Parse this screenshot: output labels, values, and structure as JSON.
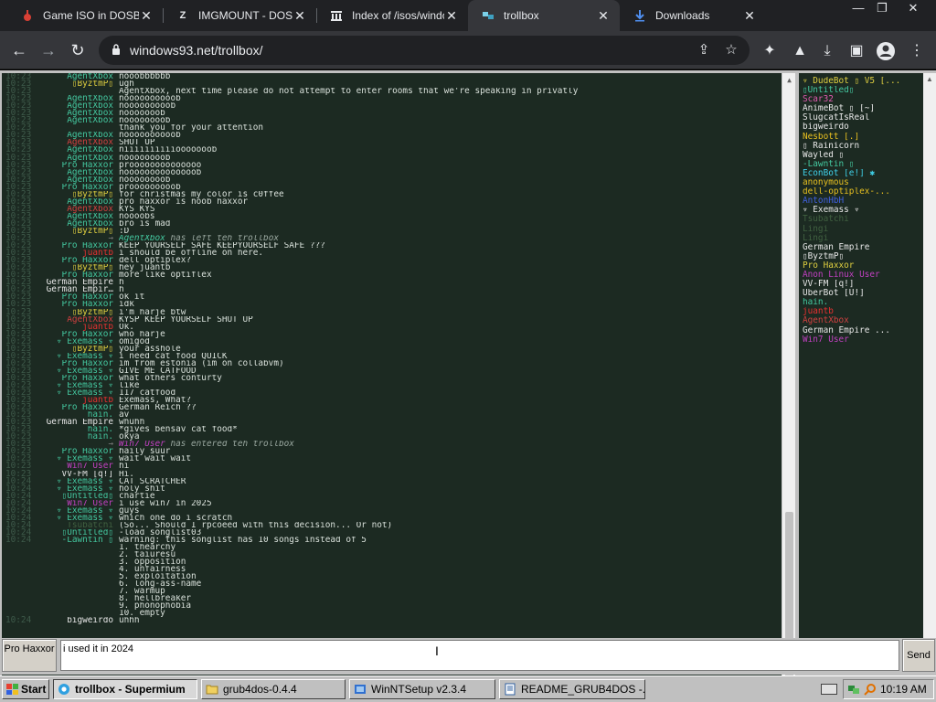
{
  "browser": {
    "tabs": [
      {
        "title": "Game ISO in DOSB",
        "icon": "controller-icon",
        "active": false
      },
      {
        "title": "IMGMOUNT - DOSI",
        "icon": "z-logo-icon",
        "active": false
      },
      {
        "title": "Index of /isos/windo",
        "icon": "archive-org-icon",
        "active": false
      },
      {
        "title": "trollbox",
        "icon": "trollbox-icon",
        "active": true
      },
      {
        "title": "Downloads",
        "icon": "download-icon",
        "active": false
      }
    ],
    "url": "windows93.net/trollbox/"
  },
  "chat": {
    "messages": [
      {
        "time": "10:23",
        "nick": "AgentXbox",
        "color": "#44c8a0",
        "text": "nooobbbbbb"
      },
      {
        "time": "10:23",
        "nick": "▯ByztmP▯",
        "color": "#e0d040",
        "text": "ugh"
      },
      {
        "time": "10:23",
        "nick": "",
        "color": "#44c8a0",
        "text": "AgentXbox, next time please do not attempt to enter rooms that we're speaking in privatly"
      },
      {
        "time": "10:23",
        "nick": "AgentXbox",
        "color": "#44c8a0",
        "text": "noooooooooob"
      },
      {
        "time": "10:23",
        "nick": "AgentXbox",
        "color": "#44c8a0",
        "text": "nooooooooob"
      },
      {
        "time": "10:23",
        "nick": "AgentXbox",
        "color": "#44c8a0",
        "text": "nooooooob"
      },
      {
        "time": "10:23",
        "nick": "AgentXbox",
        "color": "#44c8a0",
        "text": "noooooooob"
      },
      {
        "time": "10:23",
        "nick": "",
        "color": "#44c8a0",
        "text": "thank you for your attention"
      },
      {
        "time": "10:23",
        "nick": "AgentXbox",
        "color": "#44c8a0",
        "text": "noooooooooob"
      },
      {
        "time": "10:23",
        "nick": "AgentXbox",
        "color": "#d04040",
        "text": "SHUT UP"
      },
      {
        "time": "10:23",
        "nick": "AgentXbox",
        "color": "#44c8a0",
        "text": "niiiiiiiiiiooooooob"
      },
      {
        "time": "10:23",
        "nick": "AgentXbox",
        "color": "#44c8a0",
        "text": "noooooooob"
      },
      {
        "time": "10:23",
        "nick": "Pro Haxxor",
        "color": "#44c8a0",
        "text": "proooooooooooooo"
      },
      {
        "time": "10:23",
        "nick": "AgentXbox",
        "color": "#44c8a0",
        "text": "noooooooooooooob"
      },
      {
        "time": "10:23",
        "nick": "AgentXbox",
        "color": "#44c8a0",
        "text": "noooooooob"
      },
      {
        "time": "10:23",
        "nick": "Pro Haxxor",
        "color": "#44c8a0",
        "text": "prooooooooob"
      },
      {
        "time": "10:23",
        "nick": "▯ByztmP▯",
        "color": "#e0d040",
        "text": "for christmas my color is c0ffee"
      },
      {
        "time": "10:23",
        "nick": "AgentXbox",
        "color": "#44c8a0",
        "text": "pro haxxor is noob haxxor"
      },
      {
        "time": "10:23",
        "nick": "AgentXbox",
        "color": "#d04040",
        "text": "KYS KYS"
      },
      {
        "time": "10:23",
        "nick": "AgentXbox",
        "color": "#44c8a0",
        "text": "noooobs"
      },
      {
        "time": "10:23",
        "nick": "AgentXbox",
        "color": "#44c8a0",
        "text": "bro is mad"
      },
      {
        "time": "10:23",
        "nick": "▯ByztmP▯",
        "color": "#e0d040",
        "text": ":D"
      },
      {
        "time": "10:23",
        "nick": "→",
        "color": "#808080",
        "text": "",
        "system": true,
        "sys_nick": "AgentXbox",
        "sys_nick_color": "#44c8a0",
        "sys_text": " has left teh trollbox"
      },
      {
        "time": "10:23",
        "nick": "Pro Haxxor",
        "color": "#44c8a0",
        "text": "KEEP YOURSELF SAFE KEEPYOURSELF SAFE ???"
      },
      {
        "time": "10:23",
        "nick": "juantb",
        "color": "#e83030",
        "text": "i should be offline on here."
      },
      {
        "time": "10:23",
        "nick": "Pro Haxxor",
        "color": "#44c8a0",
        "text": "dell optiplex?"
      },
      {
        "time": "10:23",
        "nick": "▯ByztmP▯",
        "color": "#e0d040",
        "text": "hey juantb"
      },
      {
        "time": "10:23",
        "nick": "Pro Haxxor",
        "color": "#44c8a0",
        "text": "more like optiflex"
      },
      {
        "time": "10:23",
        "nick": "German Empire",
        "color": "#e8e8e8",
        "text": "h"
      },
      {
        "time": "10:23",
        "nick": "German Empir…",
        "color": "#e8e8e8",
        "text": "h"
      },
      {
        "time": "10:23",
        "nick": "Pro Haxxor",
        "color": "#44c8a0",
        "text": "ok it"
      },
      {
        "time": "10:23",
        "nick": "Pro Haxxor",
        "color": "#44c8a0",
        "text": "idk"
      },
      {
        "time": "10:23",
        "nick": "▯ByztmP▯",
        "color": "#e0d040",
        "text": "i'm harje btw"
      },
      {
        "time": "10:23",
        "nick": "AgentXbox",
        "color": "#d04040",
        "text": "KYSP KEEP YOURSELF SHUT UP"
      },
      {
        "time": "10:23",
        "nick": "juantb",
        "color": "#e83030",
        "text": "Ok."
      },
      {
        "time": "10:23",
        "nick": "Pro Haxxor",
        "color": "#44c8a0",
        "text": "who harje"
      },
      {
        "time": "10:23",
        "nick": "▿ Exemass ▿",
        "color": "#44c8a0",
        "text": "omigod"
      },
      {
        "time": "10:23",
        "nick": "▯ByztmP▯",
        "color": "#e0d040",
        "text": "your asshole"
      },
      {
        "time": "10:23",
        "nick": "▿ Exemass ▿",
        "color": "#44c8a0",
        "text": "i need cat food QUICK"
      },
      {
        "time": "10:23",
        "nick": "Pro Haxxor",
        "color": "#44c8a0",
        "text": "im from estonia (im on collabvm)"
      },
      {
        "time": "10:23",
        "nick": "▿ Exemass ▿",
        "color": "#44c8a0",
        "text": "GIVE ME CATFOOD"
      },
      {
        "time": "10:23",
        "nick": "Pro Haxxor",
        "color": "#44c8a0",
        "text": "what others conturty"
      },
      {
        "time": "10:23",
        "nick": "▿ Exemass ▿",
        "color": "#44c8a0",
        "text": "like"
      },
      {
        "time": "10:23",
        "nick": "▿ Exemass ▿",
        "color": "#44c8a0",
        "text": "117 catfood"
      },
      {
        "time": "10:23",
        "nick": "juantb",
        "color": "#e83030",
        "text": "Exemass, What?"
      },
      {
        "time": "10:23",
        "nick": "Pro Haxxor",
        "color": "#44c8a0",
        "text": "German Reich ??"
      },
      {
        "time": "10:23",
        "nick": "hain.",
        "color": "#44c8a0",
        "text": "av"
      },
      {
        "time": "10:23",
        "nick": "German Empire",
        "color": "#e8e8e8",
        "text": "whuhh"
      },
      {
        "time": "10:23",
        "nick": "hain.",
        "color": "#44c8a0",
        "text": "*gives bensav cat food*"
      },
      {
        "time": "10:23",
        "nick": "hain.",
        "color": "#44c8a0",
        "text": "okya"
      },
      {
        "time": "10:23",
        "nick": "→",
        "color": "#808080",
        "text": "",
        "system": true,
        "sys_nick": "Win7 User",
        "sys_nick_color": "#c040c0",
        "sys_text": " has entered teh trollbox"
      },
      {
        "time": "10:23",
        "nick": "Pro Haxxor",
        "color": "#44c8a0",
        "text": "haily suur"
      },
      {
        "time": "10:23",
        "nick": "▿ Exemass ▿",
        "color": "#44c8a0",
        "text": "wait wait wait"
      },
      {
        "time": "10:23",
        "nick": "Win7 User",
        "color": "#c040c0",
        "text": "hi"
      },
      {
        "time": "10:23",
        "nick": "VV-FM [q!]",
        "color": "#e8e8e8",
        "text": "Hi."
      },
      {
        "time": "10:24",
        "nick": "▿ Exemass ▿",
        "color": "#44c8a0",
        "text": "CAT SCRATCHER"
      },
      {
        "time": "10:24",
        "nick": "▿ Exemass ▿",
        "color": "#44c8a0",
        "text": "holy shit"
      },
      {
        "time": "10:24",
        "nick": "▯Untitled▯",
        "color": "#44c8a0",
        "text": "chartie"
      },
      {
        "time": "10:24",
        "nick": "Win7 User",
        "color": "#c040c0",
        "text": "i use win7 in 2025"
      },
      {
        "time": "10:24",
        "nick": "▿ Exemass ▿",
        "color": "#44c8a0",
        "text": "guys"
      },
      {
        "time": "10:24",
        "nick": "▿ Exemass ▿",
        "color": "#44c8a0",
        "text": "which one do i scratch"
      },
      {
        "time": "10:24",
        "nick": "Tsubatchi",
        "color": "#406040",
        "text": "(So... Should I rpcoeed with this decision... Or not)"
      },
      {
        "time": "10:24",
        "nick": "▯Untitled▯",
        "color": "#44c8a0",
        "text": "-load songlist03"
      },
      {
        "time": "10:24",
        "nick": "-Lawntin ▯",
        "color": "#44c8a0",
        "text": "warning: this songlist has 10 songs instead of 5"
      },
      {
        "time": "",
        "nick": "",
        "color": "#44c8a0",
        "text": "1. thearchy"
      },
      {
        "time": "",
        "nick": "",
        "color": "#44c8a0",
        "text": "2. taiuresu"
      },
      {
        "time": "",
        "nick": "",
        "color": "#44c8a0",
        "text": "3. opposition"
      },
      {
        "time": "",
        "nick": "",
        "color": "#44c8a0",
        "text": "4. unfairness"
      },
      {
        "time": "",
        "nick": "",
        "color": "#44c8a0",
        "text": "5. exploitation"
      },
      {
        "time": "",
        "nick": "",
        "color": "#44c8a0",
        "text": "6. long-ass-name"
      },
      {
        "time": "",
        "nick": "",
        "color": "#44c8a0",
        "text": "7. warmup"
      },
      {
        "time": "",
        "nick": "",
        "color": "#44c8a0",
        "text": "8. hellbreaker"
      },
      {
        "time": "",
        "nick": "",
        "color": "#44c8a0",
        "text": "9. phonophobia"
      },
      {
        "time": "",
        "nick": "",
        "color": "#44c8a0",
        "text": "10. empty"
      },
      {
        "time": "10:24",
        "nick": "bigweirdo",
        "color": "#e8e8e8",
        "text": "uhhh"
      }
    ]
  },
  "users": [
    {
      "name": "▿ DudeBot ▯ V5 [...",
      "color": "#e0d040"
    },
    {
      "name": "▯Untitled▯",
      "color": "#44c8a0"
    },
    {
      "name": "Scar32",
      "color": "#e05ab0"
    },
    {
      "name": "AnimeBot ▯ [~]",
      "color": "#e8e8e8"
    },
    {
      "name": "SlugcatIsReal",
      "color": "#e8e8e8"
    },
    {
      "name": "bigweirdo",
      "color": "#e8e8e8"
    },
    {
      "name": "Nesbott [.]",
      "color": "#e8c020"
    },
    {
      "name": "▯ Rainicorn",
      "color": "#e8e8e8"
    },
    {
      "name": "Wayled ▯",
      "color": "#e8e8e8"
    },
    {
      "name": "-Lawntin ▯",
      "color": "#44c8a0"
    },
    {
      "name": "EconBot [e!] ✱",
      "color": "#3fd0e8"
    },
    {
      "name": "anonymous",
      "color": "#e8c020"
    },
    {
      "name": "dell-optiplex-...",
      "color": "#e8c020"
    },
    {
      "name": "AntonHbH",
      "color": "#4060e0"
    },
    {
      "name": "▿ Exemass ▿",
      "color": "#e8e8e8"
    },
    {
      "name": "Tsubatchi",
      "color": "#406040"
    },
    {
      "name": "Lingi",
      "color": "#406040"
    },
    {
      "name": "Lingi",
      "color": "#406040"
    },
    {
      "name": "German Empire",
      "color": "#e8e8e8"
    },
    {
      "name": "▯ByztmP▯",
      "color": "#e8e8e8"
    },
    {
      "name": "Pro Haxxor",
      "color": "#e0d040"
    },
    {
      "name": "Anon Linux User",
      "color": "#c040c0"
    },
    {
      "name": "VV-FM [q!]",
      "color": "#e8e8e8"
    },
    {
      "name": "UberBot [U!]",
      "color": "#e8e8e8"
    },
    {
      "name": "hain.",
      "color": "#44c8a0"
    },
    {
      "name": "juantb",
      "color": "#e83030"
    },
    {
      "name": "AgentXbox",
      "color": "#d04040"
    },
    {
      "name": "German Empire ...",
      "color": "#e8e8e8"
    },
    {
      "name": "Win7 User",
      "color": "#c040c0"
    }
  ],
  "input": {
    "nick": "Pro Haxxor",
    "value": "i used it in 2024",
    "send_label": "Send"
  },
  "taskbar": {
    "start_label": "Start",
    "items": [
      {
        "label": "trollbox - Supermium",
        "active": true
      },
      {
        "label": "grub4dos-0.4.4",
        "active": false
      },
      {
        "label": "WinNTSetup v2.3.4",
        "active": false
      },
      {
        "label": "README_GRUB4DOS -...",
        "active": false
      }
    ],
    "clock": "10:19 AM"
  }
}
